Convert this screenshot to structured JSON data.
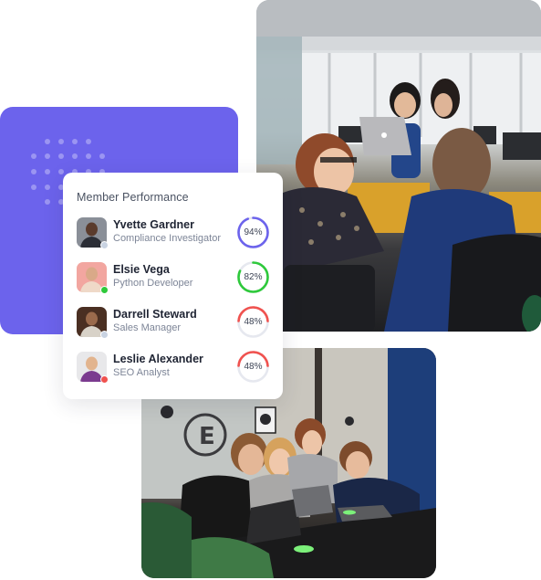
{
  "colors": {
    "brand_purple": "#6c63ec",
    "ring_track": "#e6e8ef",
    "status_offline": "#c9d3e2",
    "status_online": "#2ec93b",
    "status_busy": "#f0524f"
  },
  "decor": {
    "panel_icon": "dot-grid-pattern"
  },
  "card": {
    "title": "Member Performance",
    "members": [
      {
        "name": "Yvette Gardner",
        "role": "Compliance Investigator",
        "score_label": "94%",
        "score": 94,
        "ring_color": "#6c63ec",
        "status": "offline",
        "status_color": "#c9d3e2",
        "avatar_bg": "#8a8f98",
        "avatar_shirt": "#2b2e36",
        "avatar_skin": "#5a3b2c"
      },
      {
        "name": "Elsie Vega",
        "role": "Python Developer",
        "score_label": "82%",
        "score": 82,
        "ring_color": "#2ec93b",
        "status": "online",
        "status_color": "#2ec93b",
        "avatar_bg": "#f2a6a0",
        "avatar_shirt": "#efd9c8",
        "avatar_skin": "#d9a988"
      },
      {
        "name": "Darrell Steward",
        "role": "Sales Manager",
        "score_label": "48%",
        "score": 48,
        "ring_color": "#f0524f",
        "status": "offline",
        "status_color": "#c9d3e2",
        "avatar_bg": "#4a2f22",
        "avatar_shirt": "#d8d2c8",
        "avatar_skin": "#9a6a4c"
      },
      {
        "name": "Leslie Alexander",
        "role": "SEO Analyst",
        "score_label": "48%",
        "score": 48,
        "ring_color": "#f0524f",
        "status": "busy",
        "status_color": "#f0524f",
        "avatar_bg": "#e8e8ea",
        "avatar_shirt": "#7b3b8f",
        "avatar_skin": "#e2b48e"
      }
    ]
  },
  "photos": [
    {
      "name": "office-coworkers-photo",
      "description": "Women working together in an open office"
    },
    {
      "name": "team-meeting-photo",
      "description": "Team gathered around laptops at a meeting table"
    }
  ]
}
